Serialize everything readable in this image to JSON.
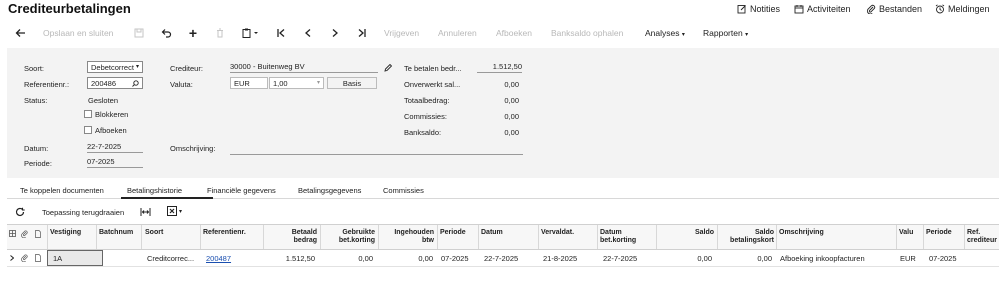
{
  "page": {
    "title": "Crediteurbetalingen"
  },
  "top_links": {
    "notes": "Notities",
    "activities": "Activiteiten",
    "files": "Bestanden",
    "notifications": "Meldingen"
  },
  "toolbar": {
    "save_close": "Opslaan en sluiten",
    "release": "Vrijgeven",
    "cancel": "Annuleren",
    "write_off": "Afboeken",
    "fetch_balance": "Banksaldo ophalen",
    "analyses": "Analyses",
    "reports": "Rapporten"
  },
  "form": {
    "type_label": "Soort:",
    "type_value": "Debetcorrect",
    "ref_label": "Referentienr.:",
    "ref_value": "200486",
    "status_label": "Status:",
    "status_value": "Gesloten",
    "block_label": "Blokkeren",
    "writeoff_label": "Afboeken",
    "date_label": "Datum:",
    "date_value": "22-7-2025",
    "period_label": "Periode:",
    "period_value": "07-2025",
    "creditor_label": "Crediteur:",
    "creditor_value": "30000 - Buitenweg BV",
    "currency_label": "Valuta:",
    "currency_value": "EUR",
    "rate_value": "1,00",
    "basis_button": "Basis",
    "description_label": "Omschrijving:",
    "description_value": "",
    "amount_due_label": "Te betalen bedr...",
    "amount_due_value": "1.512,50",
    "unprocessed_label": "Onverwerkt sal...",
    "unprocessed_value": "0,00",
    "total_label": "Totaalbedrag:",
    "total_value": "0,00",
    "commission_label": "Commissies:",
    "commission_value": "0,00",
    "bank_label": "Banksaldo:",
    "bank_value": "0,00"
  },
  "tabs": [
    "Te koppelen documenten",
    "Betalingshistorie",
    "Financiële gegevens",
    "Betalingsgegevens",
    "Commissies"
  ],
  "grid": {
    "apply_reverse": "Toepassing terugdraaien",
    "columns": {
      "branch": "Vestiging",
      "batch": "Batchnum",
      "type": "Soort",
      "ref": "Referentienr.",
      "paid1": "Betaald",
      "paid2": "bedrag",
      "used1": "Gebruikte",
      "used2": "bet.korting",
      "withheld1": "Ingehouden",
      "withheld2": "btw",
      "period": "Periode",
      "date": "Datum",
      "due": "Vervaldat.",
      "disc1": "Datum",
      "disc2": "bet.korting",
      "balance": "Saldo",
      "baldisc1": "Saldo",
      "baldisc2": "betalingskort",
      "desc": "Omschrijving",
      "cur": "Valu",
      "period2": "Periode",
      "refcred1": "Ref.",
      "refcred2": "crediteur"
    },
    "rows": [
      {
        "branch": "1A",
        "batch": "",
        "type": "Creditcorrec...",
        "ref": "200487",
        "paid": "1.512,50",
        "used": "0,00",
        "withheld": "0,00",
        "period": "07-2025",
        "date": "22-7-2025",
        "due": "21-8-2025",
        "disc_date": "22-7-2025",
        "balance": "0,00",
        "bal_disc": "0,00",
        "desc": "Afboeking inkoopfacturen",
        "cur": "EUR",
        "period2": "07-2025",
        "refcred": ""
      }
    ]
  }
}
